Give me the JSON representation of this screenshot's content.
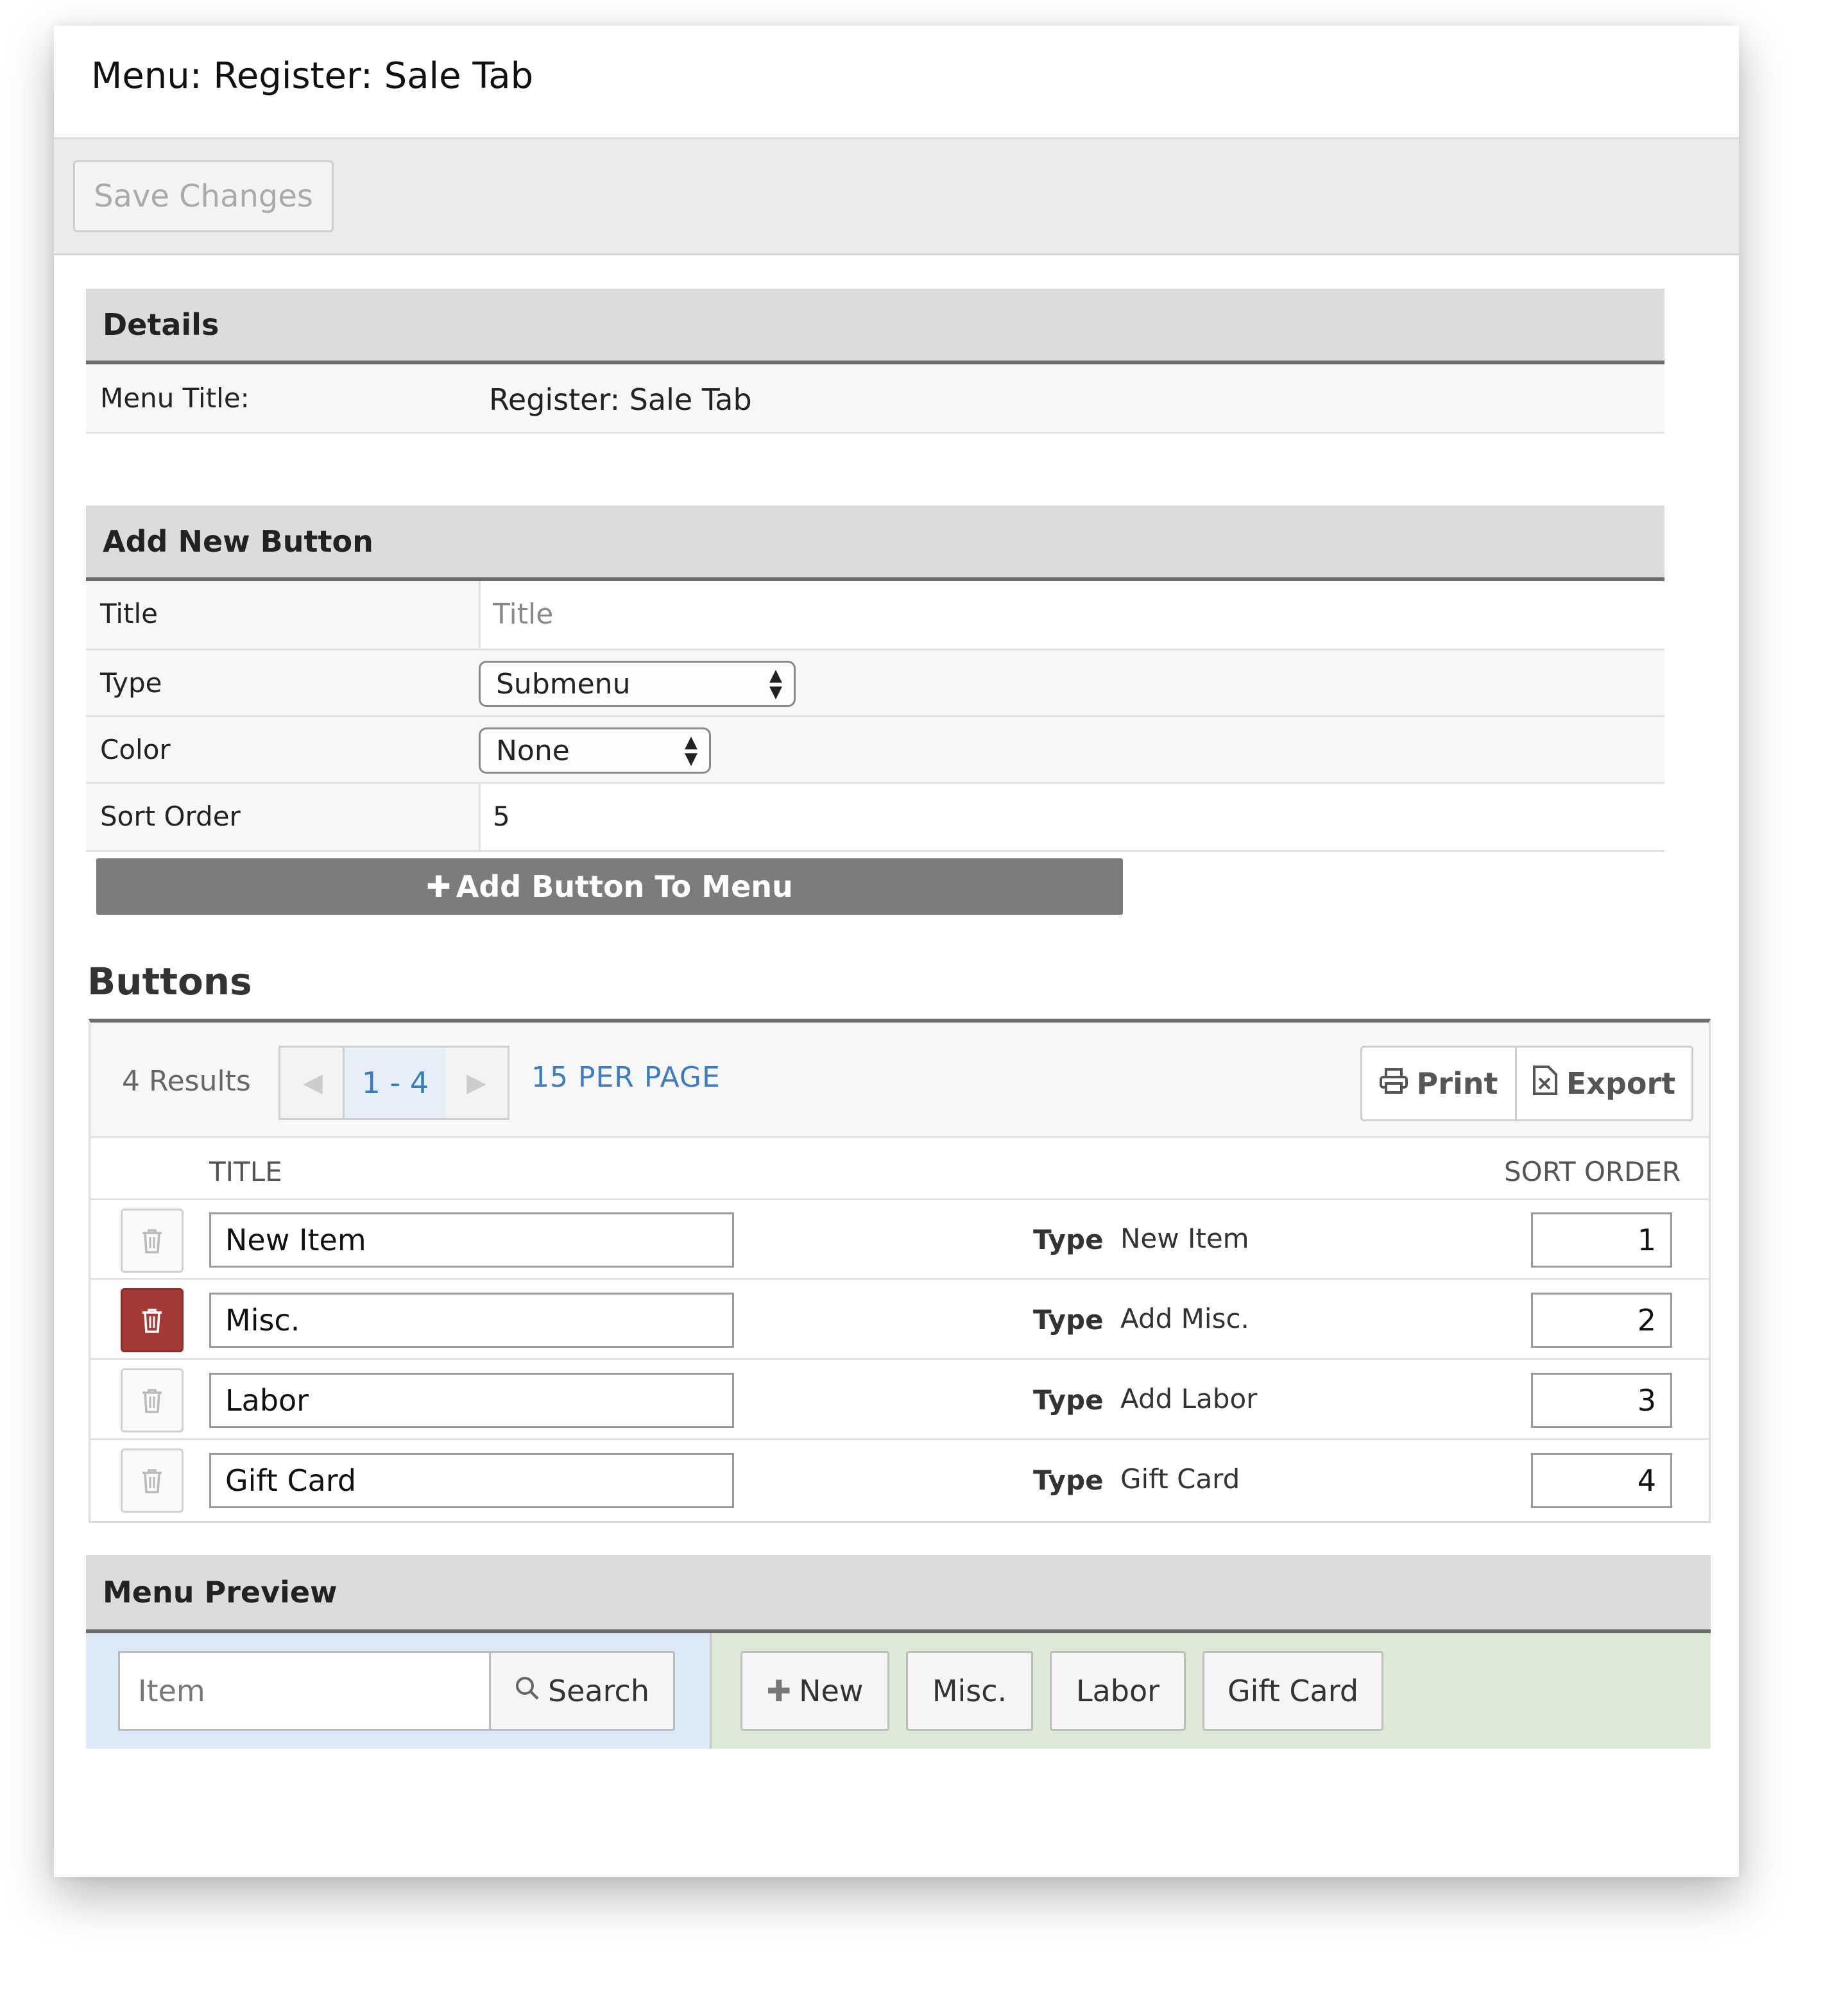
{
  "header": {
    "title": "Menu: Register: Sale Tab"
  },
  "toolbar": {
    "save_label": "Save Changes"
  },
  "details": {
    "heading": "Details",
    "menu_title_label": "Menu Title:",
    "menu_title_value": "Register: Sale Tab"
  },
  "add_new": {
    "heading": "Add New Button",
    "title_label": "Title",
    "title_placeholder": "Title",
    "type_label": "Type",
    "type_value": "Submenu",
    "color_label": "Color",
    "color_value": "None",
    "sort_label": "Sort Order",
    "sort_value": "5",
    "add_button_label": "Add Button To Menu"
  },
  "buttons": {
    "heading": "Buttons",
    "results": "4 Results",
    "page_range": "1 - 4",
    "per_page": "15 PER PAGE",
    "print_label": "Print",
    "export_label": "Export",
    "col_title": "TITLE",
    "col_sort": "SORT ORDER",
    "type_label": "Type",
    "rows": [
      {
        "title": "New Item",
        "type": "New Item",
        "sort": "1",
        "delete_active": false
      },
      {
        "title": "Misc.",
        "type": "Add Misc.",
        "sort": "2",
        "delete_active": true
      },
      {
        "title": "Labor",
        "type": "Add Labor",
        "sort": "3",
        "delete_active": false
      },
      {
        "title": "Gift Card",
        "type": "Gift Card",
        "sort": "4",
        "delete_active": false
      }
    ]
  },
  "preview": {
    "heading": "Menu Preview",
    "item_placeholder": "Item",
    "search_label": "Search",
    "buttons": [
      "New",
      "Misc.",
      "Labor",
      "Gift Card"
    ]
  },
  "colors": {
    "accent": "#3b7dc4",
    "delete_active": "#a33a35",
    "section_rule": "#6c6c6c",
    "preview_left_bg": "#dceaf7",
    "preview_right_bg": "#dfe9d7"
  }
}
